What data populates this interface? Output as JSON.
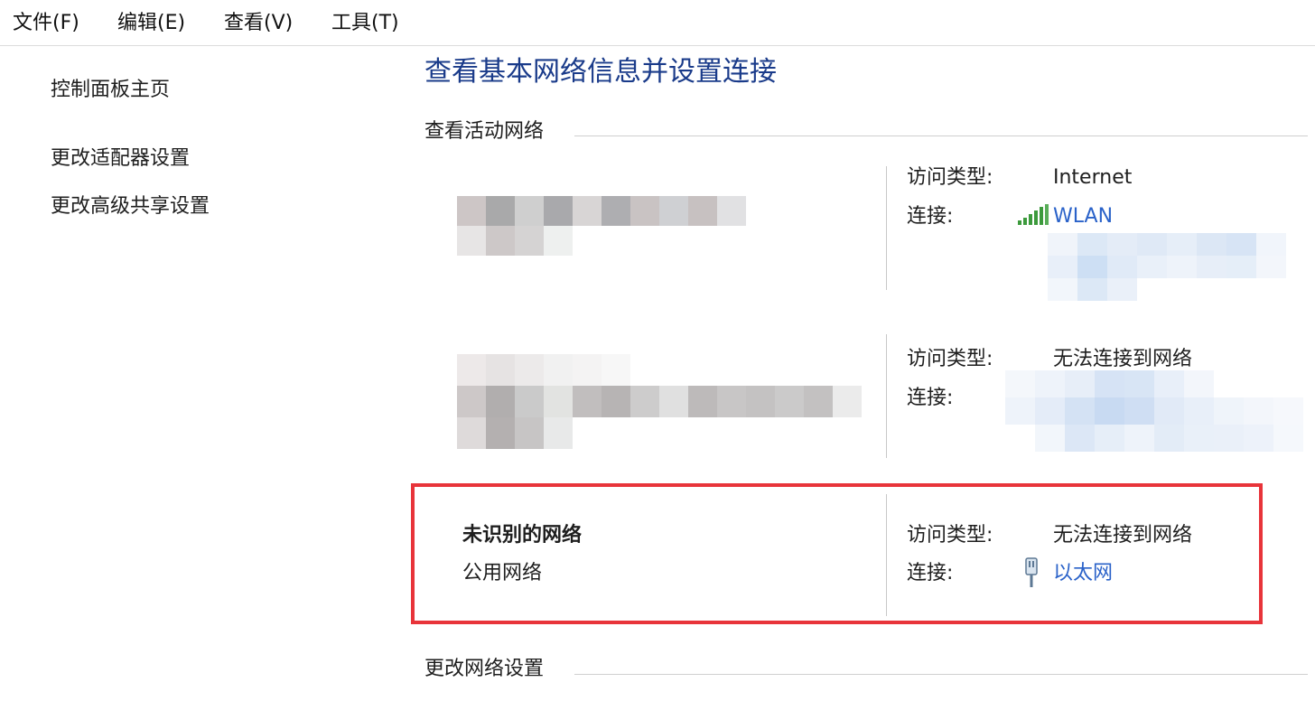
{
  "menubar": {
    "items": [
      "文件(F)",
      "编辑(E)",
      "查看(V)",
      "工具(T)"
    ]
  },
  "sidebar": {
    "links": [
      "控制面板主页",
      "更改适配器设置",
      "更改高级共享设置"
    ]
  },
  "main": {
    "title": "查看基本网络信息并设置连接",
    "active_networks_heading": "查看活动网络",
    "change_settings_heading": "更改网络设置",
    "networks": [
      {
        "name": "",
        "category": "",
        "access_type_label": "访问类型:",
        "access_type_value": "Internet",
        "connection_label": "连接:",
        "connection_value": "WLAN",
        "connection_icon": "wifi-signal-icon"
      },
      {
        "name": "",
        "category": "",
        "access_type_label": "访问类型:",
        "access_type_value": "无法连接到网络",
        "connection_label": "连接:",
        "connection_value": ""
      },
      {
        "name": "未识别的网络",
        "category": "公用网络",
        "access_type_label": "访问类型:",
        "access_type_value": "无法连接到网络",
        "connection_label": "连接:",
        "connection_value": "以太网",
        "connection_icon": "ethernet-cable-icon"
      }
    ]
  },
  "colors": {
    "title": "#1a3b8a",
    "link": "#2a62c9",
    "highlight_border": "#e8343a",
    "wifi_bars": "#3c9a3c"
  }
}
